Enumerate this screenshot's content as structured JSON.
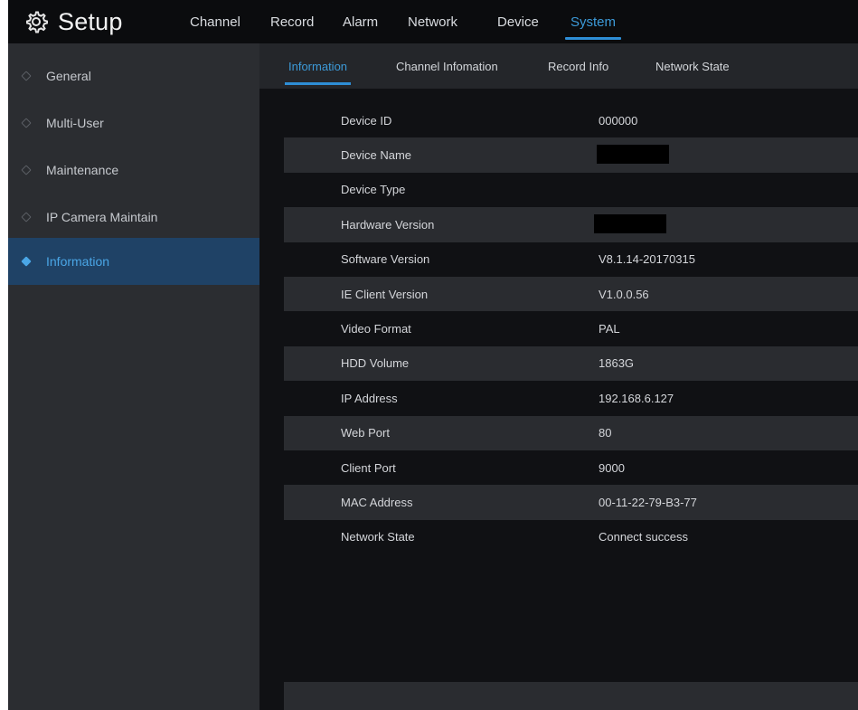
{
  "app": {
    "title": "Setup",
    "icon": "gear-icon"
  },
  "topnav": [
    {
      "label": "Channel",
      "active": false
    },
    {
      "label": "Record",
      "active": false
    },
    {
      "label": "Alarm",
      "active": false
    },
    {
      "label": "Network",
      "active": false
    },
    {
      "label": "Device",
      "active": false
    },
    {
      "label": "System",
      "active": true
    }
  ],
  "sidebar": {
    "items": [
      {
        "label": "General",
        "active": false
      },
      {
        "label": "Multi-User",
        "active": false
      },
      {
        "label": "Maintenance",
        "active": false
      },
      {
        "label": "IP Camera Maintain",
        "active": false
      },
      {
        "label": "Information",
        "active": true
      }
    ]
  },
  "subtabs": [
    {
      "label": "Information",
      "active": true
    },
    {
      "label": "Channel Infomation",
      "active": false
    },
    {
      "label": "Record Info",
      "active": false
    },
    {
      "label": "Network State",
      "active": false
    }
  ],
  "info": {
    "rows": [
      {
        "label": "Device ID",
        "value": "000000"
      },
      {
        "label": "Device Name",
        "value": ""
      },
      {
        "label": "Device Type",
        "value": ""
      },
      {
        "label": "Hardware Version",
        "value": ""
      },
      {
        "label": "Software Version",
        "value": "V8.1.14-20170315"
      },
      {
        "label": "IE Client Version",
        "value": "V1.0.0.56"
      },
      {
        "label": "Video Format",
        "value": "PAL"
      },
      {
        "label": "HDD Volume",
        "value": "1863G"
      },
      {
        "label": "IP Address",
        "value": "192.168.6.127"
      },
      {
        "label": "Web Port",
        "value": "80"
      },
      {
        "label": "Client Port",
        "value": "9000"
      },
      {
        "label": "MAC Address",
        "value": "00-11-22-79-B3-77"
      },
      {
        "label": "Network State",
        "value": "Connect success"
      }
    ]
  },
  "colors": {
    "accent": "#2e8ed6",
    "active_text": "#3c9ad8",
    "sidebar_bg": "#2b2d31",
    "sidebar_active_bg": "#1f4266",
    "content_bg": "#101114",
    "row_alt_bg": "#2a2c30",
    "topbar_bg": "#0b0c0e"
  }
}
